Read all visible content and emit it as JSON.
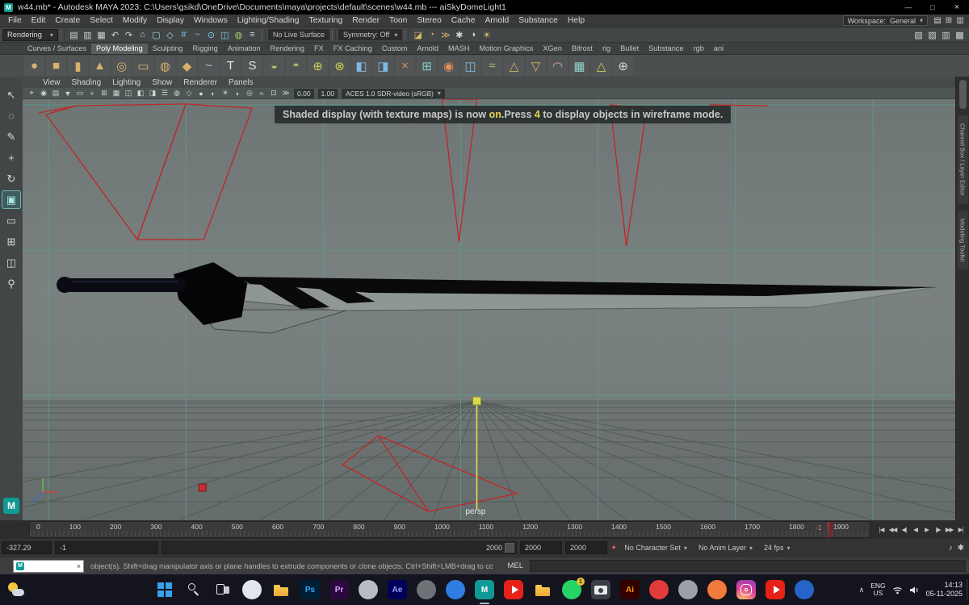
{
  "colors": {
    "viewport_bg": "#747c7c",
    "grid_teal": "#55a38c",
    "wireframe_red": "#c62222",
    "highlight_yellow": "#e8d44d",
    "maya_teal": "#0f9b95",
    "taskbar_bg": "#14141e"
  },
  "title_bar": {
    "title": "w44.mb* - Autodesk MAYA 2023: C:\\Users\\gsikd\\OneDrive\\Documents\\maya\\projects\\default\\scenes\\w44.mb   ---   aiSkyDomeLight1",
    "minimize": "—",
    "maximize": "□",
    "close": "×"
  },
  "menu_bar": {
    "items": [
      "File",
      "Edit",
      "Create",
      "Select",
      "Modify",
      "Display",
      "Windows",
      "Lighting/Shading",
      "Texturing",
      "Render",
      "Toon",
      "Stereo",
      "Cache",
      "Arnold",
      "Substance",
      "Help"
    ],
    "workspace_label": "Workspace:",
    "workspace_value": "General",
    "caret": "▾",
    "right_icons": [
      {
        "name": "workspace-save-icon",
        "glyph": "▤"
      },
      {
        "name": "panel-layout-icon",
        "glyph": "⊞"
      },
      {
        "name": "sidebar-toggle-icon",
        "glyph": "▥"
      }
    ]
  },
  "status_line": {
    "menu_set": "Rendering",
    "caret": "▾",
    "left_icons": [
      {
        "name": "new-scene-icon",
        "glyph": "▤",
        "color": "#cfd4d4"
      },
      {
        "name": "open-scene-icon",
        "glyph": "▥",
        "color": "#cfd4d4"
      },
      {
        "name": "save-scene-icon",
        "glyph": "▦",
        "color": "#cfd4d4"
      },
      {
        "name": "undo-icon",
        "glyph": "↶",
        "color": "#cfd4d4"
      },
      {
        "name": "redo-icon",
        "glyph": "↷",
        "color": "#cfd4d4"
      },
      {
        "name": "select-hierarchy-icon",
        "glyph": "⌂",
        "color": "#cfd4d4"
      },
      {
        "name": "select-object-icon",
        "glyph": "▢",
        "color": "#9fd8d2"
      },
      {
        "name": "select-component-icon",
        "glyph": "◇",
        "color": "#9fd8d2"
      },
      {
        "name": "snap-grid-icon",
        "glyph": "#",
        "color": "#7fc9e8"
      },
      {
        "name": "snap-curve-icon",
        "glyph": "~",
        "color": "#7fc9e8"
      },
      {
        "name": "snap-point-icon",
        "glyph": "⊙",
        "color": "#7fc9e8"
      },
      {
        "name": "snap-plane-icon",
        "glyph": "◫",
        "color": "#7fc9e8"
      },
      {
        "name": "make-live-icon",
        "glyph": "◍",
        "color": "#a8cf6e"
      },
      {
        "name": "construction-history-icon",
        "glyph": "≡",
        "color": "#cfd4d4"
      }
    ],
    "live_surface": "No Live Surface",
    "symmetry": "Symmetry: Off",
    "render_icons": [
      {
        "name": "render-frame-icon",
        "glyph": "◪",
        "color": "#d8b36a"
      },
      {
        "name": "ipr-render-icon",
        "glyph": "◔",
        "color": "#d8b36a"
      },
      {
        "name": "render-sequence-icon",
        "glyph": "≫",
        "color": "#d8b36a"
      },
      {
        "name": "render-settings-icon",
        "glyph": "✱",
        "color": "#cfd4d4"
      },
      {
        "name": "hypershade-icon",
        "glyph": "◑",
        "color": "#cfd4d4"
      },
      {
        "name": "light-editor-icon",
        "glyph": "☀",
        "color": "#e0c46a"
      }
    ],
    "panel_icons": [
      {
        "name": "modeling-toolkit-toggle-icon",
        "glyph": "▧",
        "color": "#cfd4d4"
      },
      {
        "name": "hypershade-toggle-icon",
        "glyph": "▨",
        "color": "#cfd4d4"
      },
      {
        "name": "attribute-editor-toggle-icon",
        "glyph": "▥",
        "color": "#cfd4d4"
      },
      {
        "name": "tool-settings-toggle-icon",
        "glyph": "▩",
        "color": "#cfd4d4"
      }
    ]
  },
  "shelf": {
    "tabs": [
      {
        "label": "Curves / Surfaces"
      },
      {
        "label": "Poly Modeling",
        "active": true
      },
      {
        "label": "Sculpting"
      },
      {
        "label": "Rigging"
      },
      {
        "label": "Animation"
      },
      {
        "label": "Rendering"
      },
      {
        "label": "FX"
      },
      {
        "label": "FX Caching"
      },
      {
        "label": "Custom"
      },
      {
        "label": "Arnold"
      },
      {
        "label": "MASH"
      },
      {
        "label": "Motion Graphics"
      },
      {
        "label": "XGen"
      },
      {
        "label": "Bifrost"
      },
      {
        "label": "rig"
      },
      {
        "label": "Bullet"
      },
      {
        "label": "Substance"
      },
      {
        "label": "rgb"
      },
      {
        "label": "ani"
      }
    ],
    "icons": [
      {
        "name": "poly-sphere-icon",
        "glyph": "●",
        "color": "#d7b36a"
      },
      {
        "name": "poly-cube-icon",
        "glyph": "■",
        "color": "#d7b36a"
      },
      {
        "name": "poly-cylinder-icon",
        "glyph": "▮",
        "color": "#d7b36a"
      },
      {
        "name": "poly-cone-icon",
        "glyph": "▲",
        "color": "#d7b36a"
      },
      {
        "name": "poly-torus-icon",
        "glyph": "◎",
        "color": "#d7b36a"
      },
      {
        "name": "poly-plane-icon",
        "glyph": "▭",
        "color": "#d7b36a"
      },
      {
        "name": "poly-disc-icon",
        "glyph": "◍",
        "color": "#d7b36a"
      },
      {
        "name": "platonic-solid-icon",
        "glyph": "◆",
        "color": "#d7b36a"
      },
      {
        "name": "sweep-mesh-icon",
        "glyph": "~",
        "color": "#8fd0c8"
      },
      {
        "name": "type-tool-icon",
        "glyph": "T",
        "color": "#e6e6e6"
      },
      {
        "name": "svg-tool-icon",
        "glyph": "S",
        "color": "#e6e6e6"
      },
      {
        "name": "boolean-union-icon",
        "glyph": "◒",
        "color": "#9fc46a"
      },
      {
        "name": "boolean-difference-icon",
        "glyph": "◓",
        "color": "#9fc46a"
      },
      {
        "name": "combine-icon",
        "glyph": "⊕",
        "color": "#c9cf55"
      },
      {
        "name": "separate-icon",
        "glyph": "⊗",
        "color": "#c9cf55"
      },
      {
        "name": "extrude-icon",
        "glyph": "◧",
        "color": "#7fb8e0"
      },
      {
        "name": "bevel-icon",
        "glyph": "◨",
        "color": "#7fb8e0"
      },
      {
        "name": "multi-cut-icon",
        "glyph": "×",
        "color": "#e08f5a"
      },
      {
        "name": "quad-draw-icon",
        "glyph": "⊞",
        "color": "#7fd0c9"
      },
      {
        "name": "target-weld-icon",
        "glyph": "◉",
        "color": "#e08f5a"
      },
      {
        "name": "mirror-icon",
        "glyph": "◫",
        "color": "#7fb8e0"
      },
      {
        "name": "smooth-icon",
        "glyph": "≈",
        "color": "#9fc46a"
      },
      {
        "name": "crease-icon",
        "glyph": "△",
        "color": "#d7b36a"
      },
      {
        "name": "reduce-icon",
        "glyph": "▽",
        "color": "#d7b36a"
      },
      {
        "name": "sculpt-brush-icon",
        "glyph": "◠",
        "color": "#dfa4c4"
      },
      {
        "name": "uv-editor-icon",
        "glyph": "▦",
        "color": "#8fd0c8"
      },
      {
        "name": "normals-icon",
        "glyph": "△",
        "color": "#c9cf55"
      },
      {
        "name": "center-pivot-icon",
        "glyph": "⊕",
        "color": "#cfd4d4"
      }
    ]
  },
  "toolbox": {
    "tools": [
      {
        "name": "select-tool",
        "glyph": "↖"
      },
      {
        "name": "lasso-tool",
        "glyph": "◌"
      },
      {
        "name": "paint-select-tool",
        "glyph": "✎"
      },
      {
        "name": "move-tool",
        "glyph": "+"
      },
      {
        "name": "rotate-tool",
        "glyph": "↻"
      },
      {
        "name": "scale-tool",
        "glyph": "▣",
        "active": true
      },
      {
        "name": "layout-single-pane-button",
        "glyph": "▭"
      },
      {
        "name": "layout-four-pane-button",
        "glyph": "⊞"
      },
      {
        "name": "layout-split-pane-button",
        "glyph": "◫"
      },
      {
        "name": "zoom-tool",
        "glyph": "⚲"
      }
    ],
    "maya_label": "M"
  },
  "viewport": {
    "menus": [
      "View",
      "Shading",
      "Lighting",
      "Show",
      "Renderer",
      "Panels"
    ],
    "toolbar_icons": [
      {
        "name": "select-camera-icon",
        "glyph": "⌖"
      },
      {
        "name": "lock-camera-icon",
        "glyph": "◉"
      },
      {
        "name": "camera-attributes-icon",
        "glyph": "▤"
      },
      {
        "name": "bookmarks-icon",
        "glyph": "▼"
      },
      {
        "name": "image-plane-icon",
        "glyph": "▭"
      },
      {
        "name": "pan-zoom-icon",
        "glyph": "+"
      },
      {
        "name": "grid-toggle-icon",
        "glyph": "⊞"
      },
      {
        "name": "film-gate-icon",
        "glyph": "▦"
      },
      {
        "name": "resolution-gate-icon",
        "glyph": "◫"
      },
      {
        "name": "gate-mask-icon",
        "glyph": "◧"
      },
      {
        "name": "field-chart-icon",
        "glyph": "◨"
      },
      {
        "name": "hud-toggle-icon",
        "glyph": "☰"
      },
      {
        "name": "xray-icon",
        "glyph": "◍"
      },
      {
        "name": "wireframe-mode-icon",
        "glyph": "◇"
      },
      {
        "name": "shaded-mode-icon",
        "glyph": "●"
      },
      {
        "name": "textured-mode-icon",
        "glyph": "◐"
      },
      {
        "name": "lights-icon",
        "glyph": "☀"
      },
      {
        "name": "shadows-icon",
        "glyph": "◗"
      },
      {
        "name": "ambient-occlusion-icon",
        "glyph": "◎"
      },
      {
        "name": "anti-aliasing-icon",
        "glyph": "≈"
      },
      {
        "name": "isolate-select-icon",
        "glyph": "⊡"
      },
      {
        "name": "motion-blur-icon",
        "glyph": "≫"
      }
    ],
    "exposure": "0.00",
    "gamma": "1.00",
    "colorspace": "ACES 1.0 SDR-video (sRGB)",
    "caret": "▾",
    "message": {
      "pre": "Shaded display (with texture maps) is now ",
      "hl1": "on",
      "mid": ".Press ",
      "hl2": "4",
      "post": " to display objects in wireframe mode."
    },
    "camera": "persp",
    "sidebar_tabs": [
      "Channel Box / Layer Editor",
      "Modeling Toolkit"
    ]
  },
  "time_slider": {
    "labels": [
      "0",
      "100",
      "200",
      "300",
      "400",
      "500",
      "600",
      "700",
      "800",
      "900",
      "1000",
      "1100",
      "1200",
      "1300",
      "1400",
      "1500",
      "1600",
      "1700",
      "1800",
      "1900"
    ],
    "current_frame": "-1",
    "playback": [
      {
        "name": "go-to-start-button",
        "glyph": "|◀"
      },
      {
        "name": "step-back-key-button",
        "glyph": "◀◀"
      },
      {
        "name": "step-back-frame-button",
        "glyph": "◀|"
      },
      {
        "name": "play-backwards-button",
        "glyph": "◀"
      },
      {
        "name": "play-forward-button",
        "glyph": "▶"
      },
      {
        "name": "step-forward-frame-button",
        "glyph": "|▶"
      },
      {
        "name": "step-forward-key-button",
        "glyph": "▶▶"
      },
      {
        "name": "go-to-end-button",
        "glyph": "▶|"
      }
    ]
  },
  "range_slider": {
    "angle_display": "-327.29",
    "start": "-1",
    "bar_label": "2000",
    "end": "2000",
    "scene_end": "2000",
    "key_glyph": "✦",
    "character_set": "No Character Set",
    "anim_layer": "No Anim Layer",
    "fps": "24 fps",
    "caret": "▾",
    "mute_glyph": "♪",
    "prefs_glyph": "✱"
  },
  "command_line": {
    "preview_label": "M",
    "close": "×",
    "help_text": "object(s). Shift+drag manipulator axis or plane handles to extrude components or clone objects. Ctrl+Shift+LMB+drag to constrain scaling to connected edges. Use D or INSERT",
    "mel_label": "MEL"
  },
  "taskbar": {
    "items": [
      {
        "name": "taskbar-start-button",
        "type": "win"
      },
      {
        "name": "taskbar-search-button",
        "type": "search"
      },
      {
        "name": "taskbar-task-view-button",
        "type": "rects"
      },
      {
        "name": "taskbar-widgets-button",
        "type": "circle",
        "bg": "#e2e6ec"
      },
      {
        "name": "taskbar-file-explorer",
        "type": "folder"
      },
      {
        "name": "taskbar-photoshop",
        "type": "tile",
        "bg": "#001e36",
        "fg": "#31a8ff",
        "label": "Ps"
      },
      {
        "name": "taskbar-premiere",
        "type": "tile",
        "bg": "#2a0a3d",
        "fg": "#d6a3ff",
        "label": "Pr"
      },
      {
        "name": "taskbar-app-circle-gray",
        "type": "circle",
        "bg": "#b9bdc1"
      },
      {
        "name": "taskbar-after-effects",
        "type": "tile",
        "bg": "#00005b",
        "fg": "#9999ff",
        "label": "Ae"
      },
      {
        "name": "taskbar-app-circle-dark",
        "type": "circle",
        "bg": "#6d7277"
      },
      {
        "name": "taskbar-app-circle-blue",
        "type": "circle",
        "bg": "#2f7de1"
      },
      {
        "name": "taskbar-maya",
        "type": "tile",
        "bg": "#0f9b95",
        "fg": "#ffffff",
        "label": "M",
        "active": true
      },
      {
        "name": "taskbar-youtube",
        "type": "play",
        "bg": "#e62117"
      },
      {
        "name": "taskbar-folder-projects",
        "type": "folder"
      },
      {
        "name": "taskbar-whatsapp",
        "type": "circle",
        "bg": "#25d366",
        "badge": "1"
      },
      {
        "name": "taskbar-camera-app",
        "type": "camera",
        "bg": "#3a3f46"
      },
      {
        "name": "taskbar-illustrator",
        "type": "tile",
        "bg": "#330000",
        "fg": "#ff9a00",
        "label": "Ai"
      },
      {
        "name": "taskbar-app-circle-red",
        "type": "circle",
        "bg": "#e23b3b"
      },
      {
        "name": "taskbar-app-circle-steel",
        "type": "circle",
        "bg": "#9aa0a6"
      },
      {
        "name": "taskbar-app-circle-orange",
        "type": "circle",
        "bg": "#f07b3c"
      },
      {
        "name": "taskbar-instagram",
        "type": "insta"
      },
      {
        "name": "taskbar-youtube-2",
        "type": "play",
        "bg": "#e62117"
      },
      {
        "name": "taskbar-edge",
        "type": "circle",
        "bg": "#2565c9"
      }
    ],
    "tray": {
      "chevron": "∧",
      "lang1": "ENG",
      "lang2": "US",
      "time": "14:13",
      "date": "05-11-2025"
    }
  }
}
